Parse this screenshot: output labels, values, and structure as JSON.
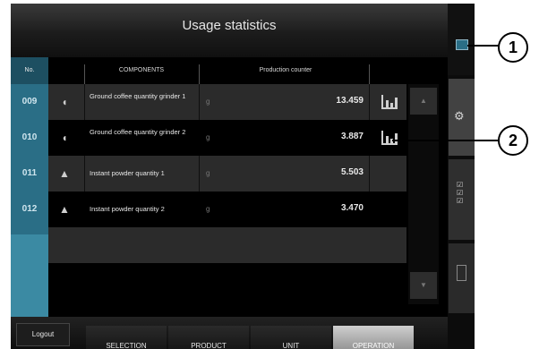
{
  "header": {
    "title": "Usage statistics"
  },
  "table": {
    "columns": {
      "no": "No.",
      "components": "COMPONENTS",
      "production": "Production counter"
    },
    "rows": [
      {
        "no": "009",
        "icon": "coffee-bean-icon",
        "name": "Ground coffee quantity grinder 1",
        "unit": "g",
        "value": "13.459",
        "has_chart": true
      },
      {
        "no": "010",
        "icon": "coffee-bean-icon",
        "name": "Ground coffee quantity grinder 2",
        "unit": "g",
        "value": "3.887",
        "has_chart": true
      },
      {
        "no": "011",
        "icon": "powder-icon",
        "name": "Instant powder quantity 1",
        "unit": "g",
        "value": "5.503",
        "has_chart": false
      },
      {
        "no": "012",
        "icon": "powder-icon",
        "name": "Instant powder quantity 2",
        "unit": "g",
        "value": "3.470",
        "has_chart": false
      }
    ]
  },
  "bottom": {
    "logout": "Logout",
    "tabs": [
      {
        "label": "SELECTION",
        "active": false
      },
      {
        "label": "PRODUCT",
        "active": false
      },
      {
        "label": "UNIT",
        "active": false
      },
      {
        "label": "OPERATION",
        "active": true
      }
    ]
  },
  "callouts": {
    "c1": "1",
    "c2": "2"
  },
  "colors": {
    "accent": "#2a6e86",
    "row_dark": "#2b2b2b"
  }
}
